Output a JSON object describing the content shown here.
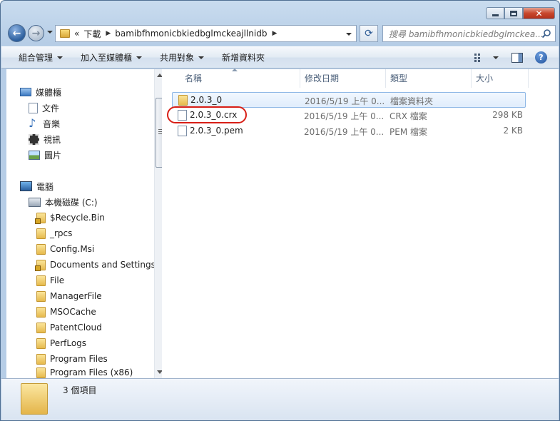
{
  "address": {
    "overflow": "«",
    "crumbs": [
      "下載",
      "bamibfhmonicbkiedbglmckeajllnidb"
    ]
  },
  "search": {
    "placeholder": "搜尋 bamibfhmonicbkiedbglmckea..."
  },
  "toolbar": {
    "organize": "組合管理",
    "include_library": "加入至媒體櫃",
    "share": "共用對象",
    "new_folder": "新增資料夾"
  },
  "nav": {
    "libraries": "媒體櫃",
    "lib_items": [
      "文件",
      "音樂",
      "視訊",
      "圖片"
    ],
    "computer": "電腦",
    "drive": "本機磁碟 (C:)",
    "folders": [
      "$Recycle.Bin",
      "_rpcs",
      "Config.Msi",
      "Documents and Settings",
      "File",
      "ManagerFile",
      "MSOCache",
      "PatentCloud",
      "PerfLogs",
      "Program Files",
      "Program Files (x86)"
    ]
  },
  "columns": {
    "name": "名稱",
    "date": "修改日期",
    "type": "類型",
    "size": "大小"
  },
  "files": [
    {
      "name": "2.0.3_0",
      "date": "2016/5/19 上午 0...",
      "type": "檔案資料夾",
      "size": ""
    },
    {
      "name": "2.0.3_0.crx",
      "date": "2016/5/19 上午 0...",
      "type": "CRX 檔案",
      "size": "298 KB"
    },
    {
      "name": "2.0.3_0.pem",
      "date": "2016/5/19 上午 0...",
      "type": "PEM 檔案",
      "size": "2 KB"
    }
  ],
  "status": {
    "item_count": "3 個項目"
  },
  "colors": {
    "highlight_ring": "#d81e16",
    "selection": "#e0edfc"
  }
}
